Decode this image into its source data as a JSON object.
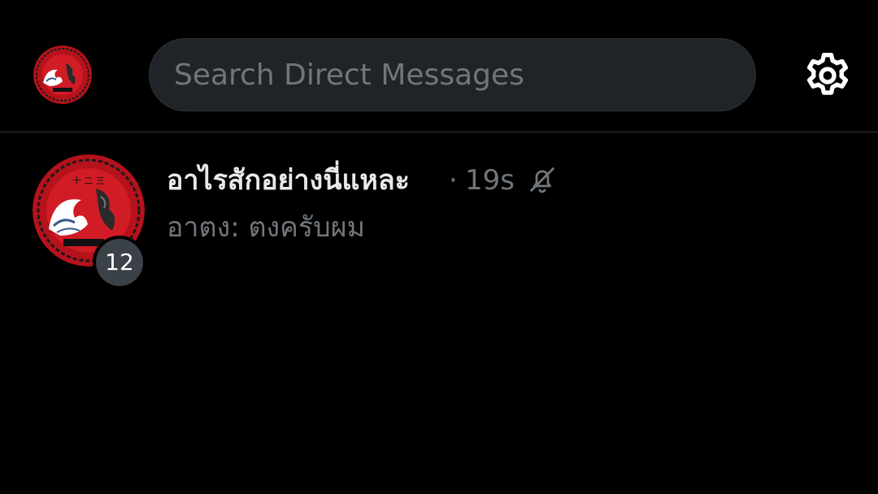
{
  "header": {
    "profile_avatar_icon": "profile-avatar-icon",
    "search": {
      "placeholder": "Search Direct Messages",
      "value": ""
    },
    "settings_icon": "gear-icon"
  },
  "conversations": [
    {
      "name": "อาไรสักอย่างนี่แหละ",
      "separator": "·",
      "time": "19s",
      "muted_icon": "bell-off-icon",
      "preview": "อาตง: ตงครับผม",
      "unread_count": "12",
      "avatar_icon": "group-avatar-icon"
    }
  ],
  "colors": {
    "background": "#000000",
    "primary_text": "#e7e9ea",
    "secondary_text": "#71767b",
    "search_bg": "#202327",
    "divider": "#2f3336",
    "badge_bg": "#3a4148",
    "avatar_red": "#c8102e"
  }
}
